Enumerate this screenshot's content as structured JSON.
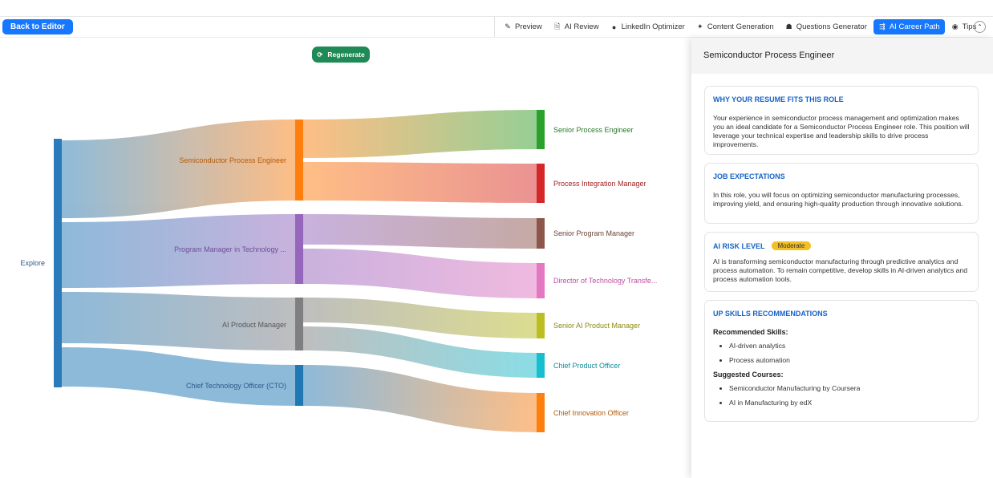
{
  "toolbar": {
    "back_label": "Back to Editor",
    "tabs": [
      {
        "label": "Preview",
        "icon": "pen-icon"
      },
      {
        "label": "AI Review",
        "icon": "review-icon"
      },
      {
        "label": "LinkedIn Optimizer",
        "icon": "linkedin-icon"
      },
      {
        "label": "Content Generation",
        "icon": "sparkle-icon"
      },
      {
        "label": "Questions Generator",
        "icon": "bot-icon"
      },
      {
        "label": "AI Career Path",
        "icon": "career-path-icon",
        "active": true
      },
      {
        "label": "Tips",
        "icon": "bulb-icon"
      }
    ],
    "collapse_icon": "chevron-up-icon"
  },
  "regenerate": {
    "label": "Regenerate",
    "icon": "refresh-icon"
  },
  "sankey": {
    "source": {
      "label": "Explore",
      "color": "#2b7bba"
    },
    "roles": [
      {
        "label": "Semiconductor Process Engineer",
        "color": "#ff7f0e",
        "label_color": "#b35a0a"
      },
      {
        "label": "Program Manager in Technology ...",
        "color": "#9467bd",
        "label_color": "#6f4e9a"
      },
      {
        "label": "AI Product Manager",
        "color": "#7f7f7f",
        "label_color": "#555555"
      },
      {
        "label": "Chief Technology Officer (CTO)",
        "color": "#1f77b4",
        "label_color": "#2b5a8a"
      }
    ],
    "targets": [
      {
        "label": "Senior Process Engineer",
        "color": "#2ca02c",
        "label_color": "#2a7a2a"
      },
      {
        "label": "Process Integration Manager",
        "color": "#d62728",
        "label_color": "#a01e1e"
      },
      {
        "label": "Senior Program Manager",
        "color": "#8c564b",
        "label_color": "#6d4239"
      },
      {
        "label": "Director of Technology Transfe...",
        "color": "#e377c2",
        "label_color": "#c04fa0"
      },
      {
        "label": "Senior AI Product Manager",
        "color": "#bcbd22",
        "label_color": "#8a8a10"
      },
      {
        "label": "Chief Product Officer",
        "color": "#17becf",
        "label_color": "#128d9a"
      },
      {
        "label": "Chief Innovation Officer",
        "color": "#ff7f0e",
        "label_color": "#b35a0a"
      }
    ]
  },
  "panel": {
    "title": "Semiconductor Process Engineer",
    "fits_title": "WHY YOUR RESUME FITS THIS ROLE",
    "fits_body": "Your experience in semiconductor process management and optimization makes you an ideal candidate for a Semiconductor Process Engineer role. This position will leverage your technical expertise and leadership skills to drive process improvements.",
    "expect_title": "JOB EXPECTATIONS",
    "expect_body": "In this role, you will focus on optimizing semiconductor manufacturing processes, improving yield, and ensuring high-quality production through innovative solutions.",
    "risk_title": "AI RISK LEVEL",
    "risk_badge": "Moderate",
    "risk_color": "#f2bf26",
    "risk_body": "AI is transforming semiconductor manufacturing through predictive analytics and process automation. To remain competitive, develop skills in AI-driven analytics and process automation tools.",
    "upskill_title": "UP SKILLS RECOMMENDATIONS",
    "skills_label": "Recommended Skills:",
    "skills": [
      "AI-driven analytics",
      "Process automation"
    ],
    "courses_label": "Suggested Courses:",
    "courses": [
      "Semiconductor Manufacturing by Coursera",
      "AI in Manufacturing by edX"
    ]
  }
}
